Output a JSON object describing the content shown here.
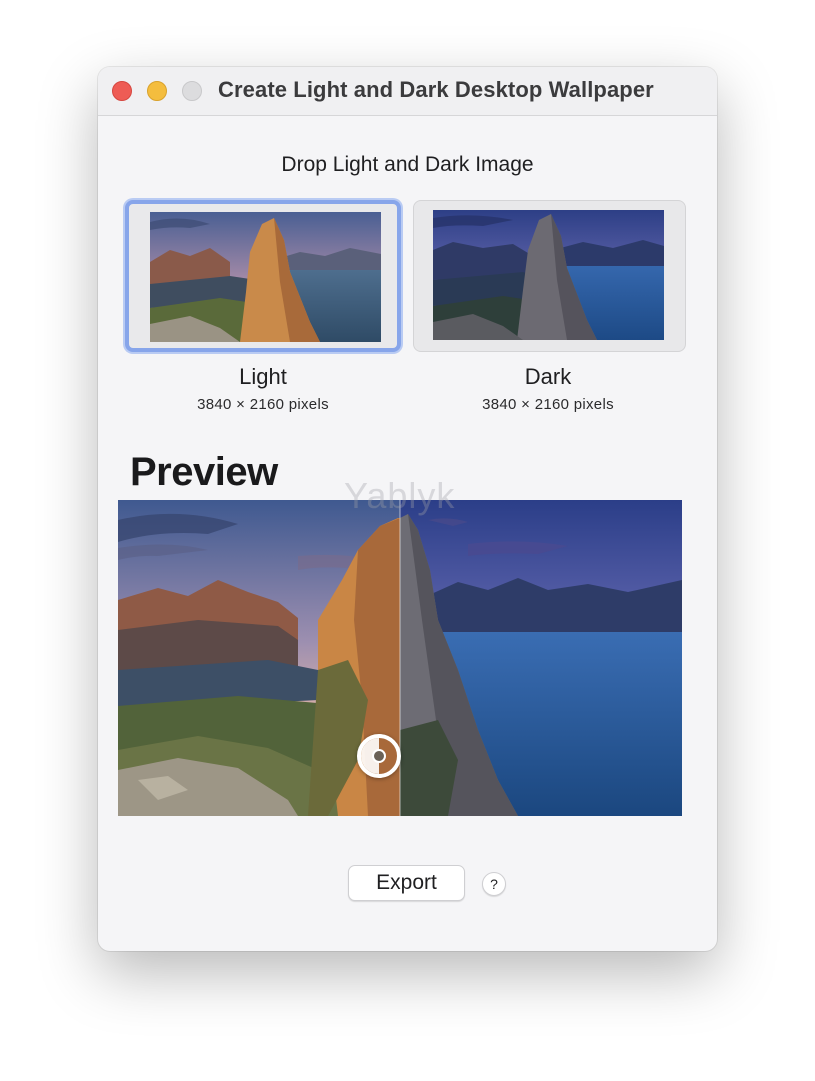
{
  "window": {
    "title": "Create Light and Dark Desktop Wallpaper"
  },
  "drop_area": {
    "caption": "Drop Light and Dark Image",
    "light": {
      "label": "Light",
      "size": "3840 × 2160 pixels"
    },
    "dark": {
      "label": "Dark",
      "size": "3840 × 2160 pixels"
    }
  },
  "preview": {
    "heading": "Preview",
    "watermark": "Yablyk",
    "split_position": 0.5
  },
  "actions": {
    "export_label": "Export",
    "help_label": "?"
  },
  "icons": {
    "close": "close-traffic-light",
    "minimize": "minimize-traffic-light",
    "zoom": "zoom-traffic-light",
    "slider": "appearance-slider-handle"
  },
  "colors": {
    "close": "#ee5c55",
    "minimize": "#f4bd3e",
    "zoom_disabled": "#dcdcde",
    "selection_ring": "#87a5ea"
  }
}
